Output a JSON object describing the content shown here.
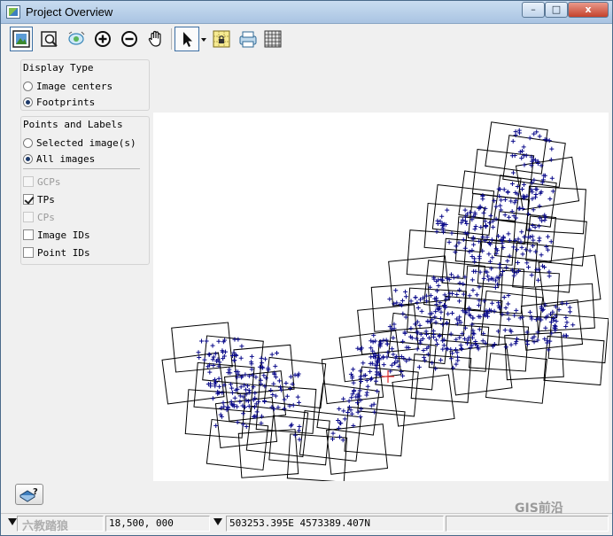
{
  "window": {
    "title": "Project Overview",
    "minimize": "–",
    "maximize": "□",
    "close": "x"
  },
  "toolbar": [
    {
      "name": "full-extent-icon"
    },
    {
      "name": "zoom-box-icon"
    },
    {
      "name": "zoom-to-selection-icon"
    },
    {
      "name": "zoom-in-icon"
    },
    {
      "name": "zoom-out-icon"
    },
    {
      "name": "pan-hand-icon"
    },
    {
      "name": "select-pointer-icon"
    },
    {
      "name": "dropdown-arrow-icon"
    },
    {
      "name": "lock-icon"
    },
    {
      "name": "printer-icon"
    },
    {
      "name": "table-icon"
    }
  ],
  "display_type": {
    "title": "Display Type",
    "options": [
      {
        "label": "Image centers",
        "checked": false
      },
      {
        "label": "Footprints",
        "checked": true
      }
    ]
  },
  "points_labels": {
    "title": "Points and Labels",
    "options": [
      {
        "label": "Selected image(s)",
        "checked": false
      },
      {
        "label": "All images",
        "checked": true
      }
    ],
    "checkboxes": [
      {
        "label": "GCPs",
        "checked": false,
        "enabled": false
      },
      {
        "label": "TPs",
        "checked": true,
        "enabled": false
      },
      {
        "label": "CPs",
        "checked": false,
        "enabled": false
      },
      {
        "label": "Image IDs",
        "checked": false,
        "enabled": true
      },
      {
        "label": "Point IDs",
        "checked": false,
        "enabled": true
      }
    ]
  },
  "status": {
    "scale": "1: 18,500, 000",
    "scale_shown": "18,500, 000",
    "coordinates": "503253.395E 4573389.407N"
  },
  "watermark": {
    "right": "GIS前沿",
    "left": "六教踏狼"
  },
  "colors": {
    "footprint": "#000000",
    "tie_point": "#0a0a8a",
    "cursor": "#e03030"
  }
}
